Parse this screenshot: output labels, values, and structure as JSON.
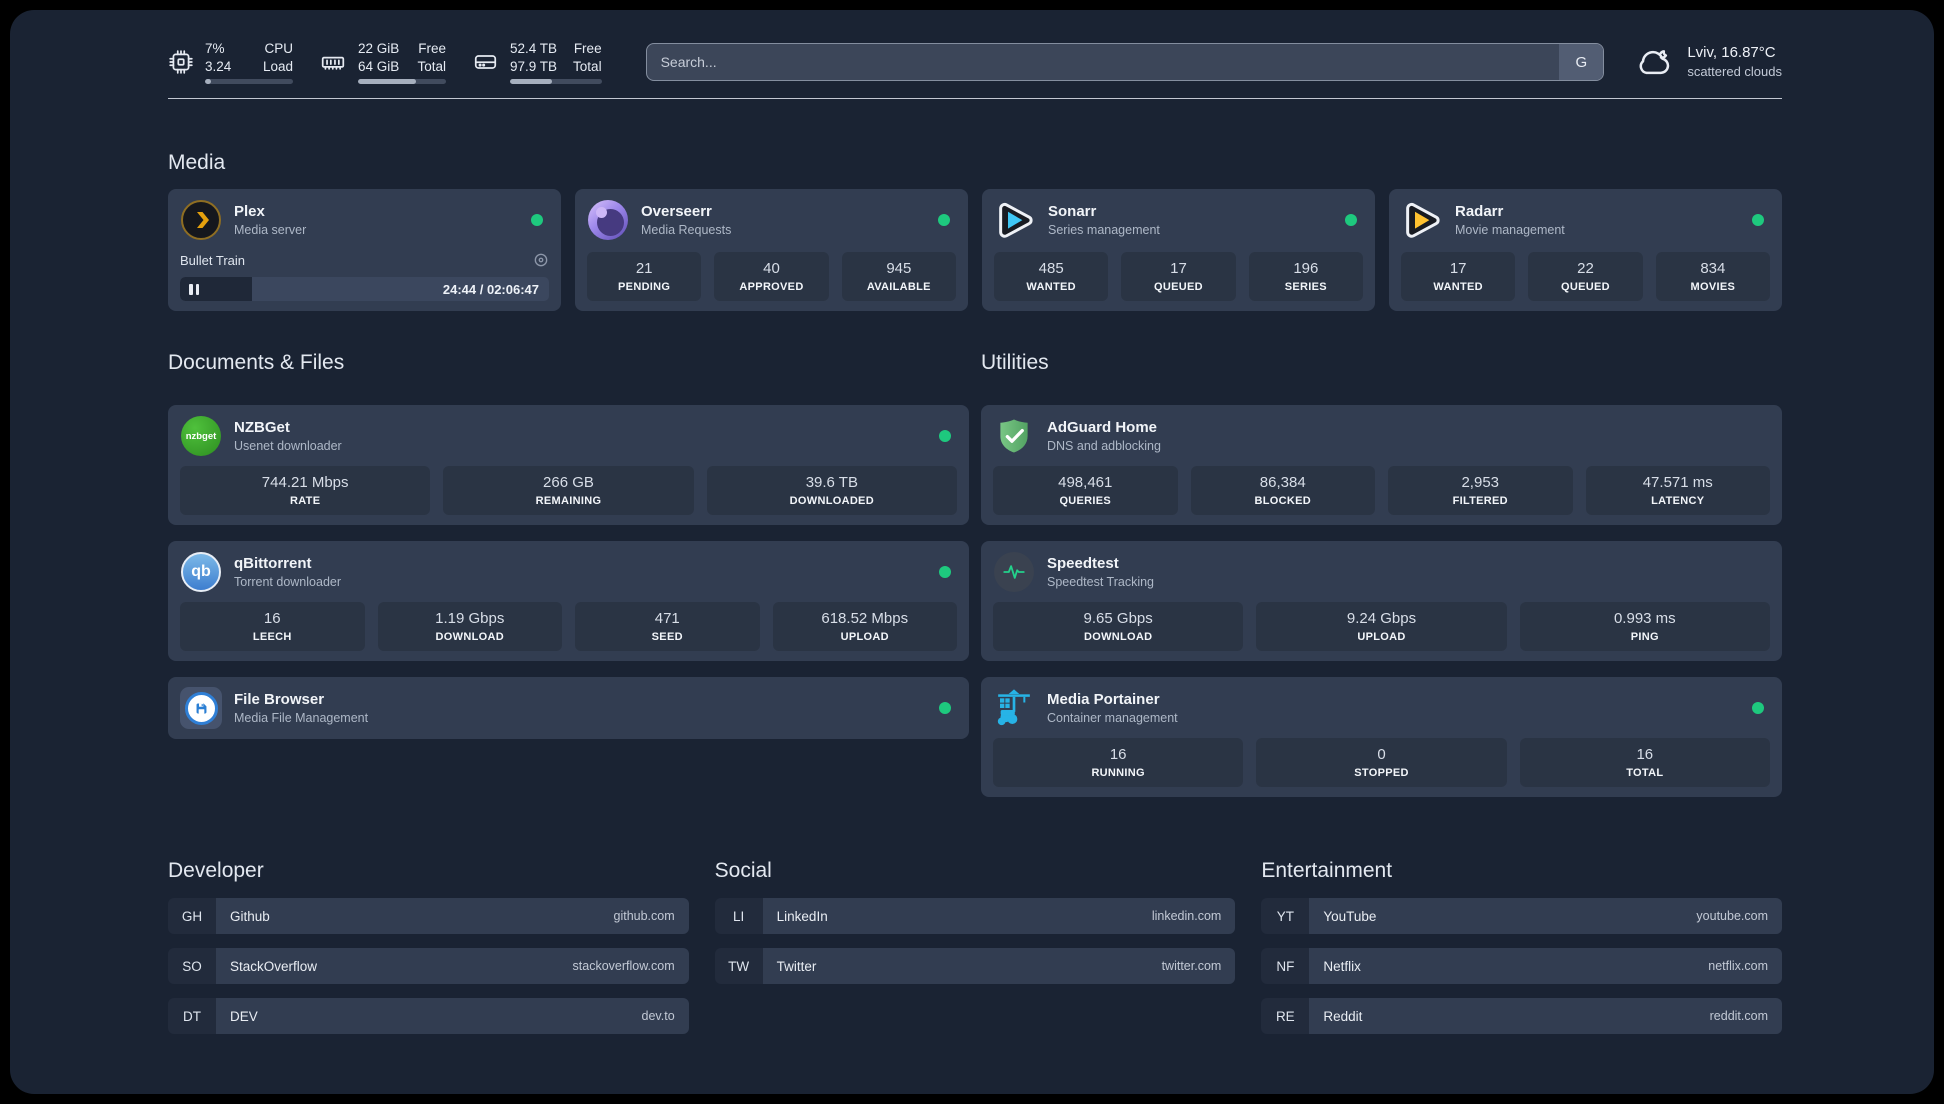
{
  "header": {
    "stats": [
      {
        "icon": "cpu-chip-icon",
        "col1": [
          "7%",
          "3.24"
        ],
        "col2": [
          "CPU",
          "Load"
        ],
        "percent": 7
      },
      {
        "icon": "memory-icon",
        "col1": [
          "22 GiB",
          "64 GiB"
        ],
        "col2": [
          "Free",
          "Total"
        ],
        "percent": 66
      },
      {
        "icon": "disk-icon",
        "col1": [
          "52.4 TB",
          "97.9 TB"
        ],
        "col2": [
          "Free",
          "Total"
        ],
        "percent": 46
      }
    ],
    "search": {
      "placeholder": "Search...",
      "engine_button": "G"
    },
    "weather": {
      "location": "Lviv, 16.87°C",
      "condition": "scattered clouds"
    }
  },
  "media": {
    "title": "Media",
    "plex": {
      "name": "Plex",
      "description": "Media server",
      "now_playing": "Bullet Train",
      "time": "24:44 / 02:06:47",
      "progress_percent": 19.5
    },
    "overseerr": {
      "name": "Overseerr",
      "description": "Media Requests",
      "stats": [
        {
          "value": "21",
          "label": "PENDING"
        },
        {
          "value": "40",
          "label": "APPROVED"
        },
        {
          "value": "945",
          "label": "AVAILABLE"
        }
      ]
    },
    "sonarr": {
      "name": "Sonarr",
      "description": "Series management",
      "stats": [
        {
          "value": "485",
          "label": "WANTED"
        },
        {
          "value": "17",
          "label": "QUEUED"
        },
        {
          "value": "196",
          "label": "SERIES"
        }
      ]
    },
    "radarr": {
      "name": "Radarr",
      "description": "Movie management",
      "stats": [
        {
          "value": "17",
          "label": "WANTED"
        },
        {
          "value": "22",
          "label": "QUEUED"
        },
        {
          "value": "834",
          "label": "MOVIES"
        }
      ]
    }
  },
  "documents": {
    "title": "Documents & Files",
    "nzbget": {
      "name": "NZBGet",
      "description": "Usenet downloader",
      "stats": [
        {
          "value": "744.21 Mbps",
          "label": "RATE"
        },
        {
          "value": "266 GB",
          "label": "REMAINING"
        },
        {
          "value": "39.6 TB",
          "label": "DOWNLOADED"
        }
      ]
    },
    "qbittorrent": {
      "name": "qBittorrent",
      "description": "Torrent downloader",
      "stats": [
        {
          "value": "16",
          "label": "LEECH"
        },
        {
          "value": "1.19 Gbps",
          "label": "DOWNLOAD"
        },
        {
          "value": "471",
          "label": "SEED"
        },
        {
          "value": "618.52 Mbps",
          "label": "UPLOAD"
        }
      ]
    },
    "filebrowser": {
      "name": "File Browser",
      "description": "Media File Management"
    }
  },
  "utilities": {
    "title": "Utilities",
    "adguard": {
      "name": "AdGuard Home",
      "description": "DNS and adblocking",
      "stats": [
        {
          "value": "498,461",
          "label": "QUERIES"
        },
        {
          "value": "86,384",
          "label": "BLOCKED"
        },
        {
          "value": "2,953",
          "label": "FILTERED"
        },
        {
          "value": "47.571 ms",
          "label": "LATENCY"
        }
      ]
    },
    "speedtest": {
      "name": "Speedtest",
      "description": "Speedtest Tracking",
      "stats": [
        {
          "value": "9.65 Gbps",
          "label": "DOWNLOAD"
        },
        {
          "value": "9.24 Gbps",
          "label": "UPLOAD"
        },
        {
          "value": "0.993 ms",
          "label": "PING"
        }
      ]
    },
    "portainer": {
      "name": "Media Portainer",
      "description": "Container management",
      "stats": [
        {
          "value": "16",
          "label": "RUNNING"
        },
        {
          "value": "0",
          "label": "STOPPED"
        },
        {
          "value": "16",
          "label": "TOTAL"
        }
      ]
    }
  },
  "bookmarks": {
    "developer": {
      "title": "Developer",
      "links": [
        {
          "abbr": "GH",
          "name": "Github",
          "domain": "github.com"
        },
        {
          "abbr": "SO",
          "name": "StackOverflow",
          "domain": "stackoverflow.com"
        },
        {
          "abbr": "DT",
          "name": "DEV",
          "domain": "dev.to"
        }
      ]
    },
    "social": {
      "title": "Social",
      "links": [
        {
          "abbr": "LI",
          "name": "LinkedIn",
          "domain": "linkedin.com"
        },
        {
          "abbr": "TW",
          "name": "Twitter",
          "domain": "twitter.com"
        }
      ]
    },
    "entertainment": {
      "title": "Entertainment",
      "links": [
        {
          "abbr": "YT",
          "name": "YouTube",
          "domain": "youtube.com"
        },
        {
          "abbr": "NF",
          "name": "Netflix",
          "domain": "netflix.com"
        },
        {
          "abbr": "RE",
          "name": "Reddit",
          "domain": "reddit.com"
        }
      ]
    }
  },
  "colors": {
    "status_online": "#1ec97e",
    "nzbget_logo_text": "nzbget",
    "qbittorrent_logo_text": "qb"
  }
}
